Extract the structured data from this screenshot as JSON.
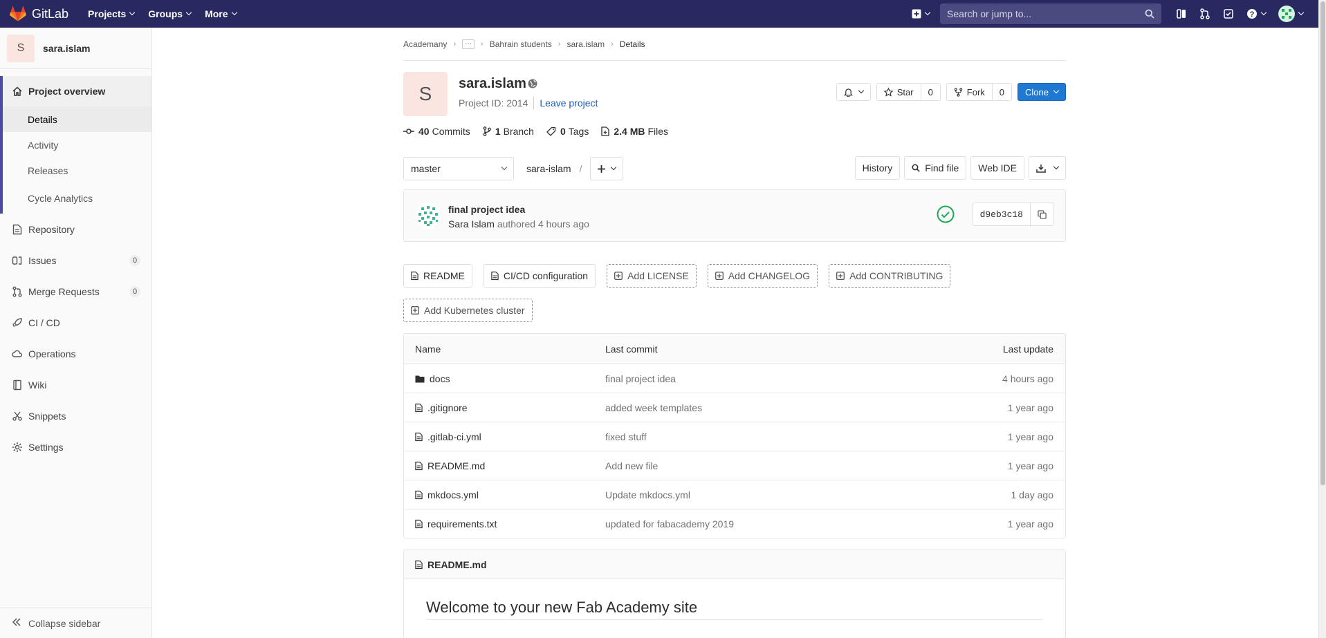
{
  "navbar": {
    "brand": "GitLab",
    "menu": [
      "Projects",
      "Groups",
      "More"
    ],
    "search_placeholder": "Search or jump to..."
  },
  "sidebar": {
    "project_initial": "S",
    "project_name": "sara.islam",
    "overview_label": "Project overview",
    "overview_items": [
      "Details",
      "Activity",
      "Releases",
      "Cycle Analytics"
    ],
    "items": [
      {
        "label": "Repository"
      },
      {
        "label": "Issues",
        "badge": "0"
      },
      {
        "label": "Merge Requests",
        "badge": "0"
      },
      {
        "label": "CI / CD"
      },
      {
        "label": "Operations"
      },
      {
        "label": "Wiki"
      },
      {
        "label": "Snippets"
      },
      {
        "label": "Settings"
      }
    ],
    "collapse_label": "Collapse sidebar"
  },
  "breadcrumb": {
    "items": [
      "Academany",
      "Bahrain students",
      "sara.islam",
      "Details"
    ]
  },
  "project": {
    "initial": "S",
    "title": "sara.islam",
    "id_text": "Project ID: 2014",
    "leave_label": "Leave project",
    "star_label": "Star",
    "star_count": "0",
    "fork_label": "Fork",
    "fork_count": "0",
    "clone_label": "Clone"
  },
  "stats": {
    "commits_count": "40",
    "commits_label": "Commits",
    "branch_count": "1",
    "branch_label": "Branch",
    "tags_count": "0",
    "tags_label": "Tags",
    "files_size": "2.4 MB",
    "files_label": "Files"
  },
  "toolbar": {
    "branch": "master",
    "path": "sara-islam",
    "path_sep": "/",
    "history": "History",
    "find_file": "Find file",
    "web_ide": "Web IDE"
  },
  "commit": {
    "title": "final project idea",
    "author": "Sara Islam",
    "meta": "authored 4 hours ago",
    "sha": "d9eb3c18"
  },
  "quick_links": [
    {
      "label": "README",
      "style": "solid",
      "icon": "file-icon"
    },
    {
      "label": "CI/CD configuration",
      "style": "solid",
      "icon": "file-icon"
    },
    {
      "label": "Add LICENSE",
      "style": "dashed",
      "icon": "plus-square-icon"
    },
    {
      "label": "Add CHANGELOG",
      "style": "dashed",
      "icon": "plus-square-icon"
    },
    {
      "label": "Add CONTRIBUTING",
      "style": "dashed",
      "icon": "plus-square-icon"
    },
    {
      "label": "Add Kubernetes cluster",
      "style": "dashed",
      "icon": "plus-square-icon"
    }
  ],
  "file_table": {
    "headers": [
      "Name",
      "Last commit",
      "Last update"
    ],
    "rows": [
      {
        "name": "docs",
        "type": "folder",
        "commit": "final project idea",
        "update": "4 hours ago"
      },
      {
        "name": ".gitignore",
        "type": "file",
        "commit": "added week templates",
        "update": "1 year ago"
      },
      {
        "name": ".gitlab-ci.yml",
        "type": "file",
        "commit": "fixed stuff",
        "update": "1 year ago"
      },
      {
        "name": "README.md",
        "type": "file",
        "commit": "Add new file",
        "update": "1 year ago"
      },
      {
        "name": "mkdocs.yml",
        "type": "file",
        "commit": "Update mkdocs.yml",
        "update": "1 day ago"
      },
      {
        "name": "requirements.txt",
        "type": "file",
        "commit": "updated for fabacademy 2019",
        "update": "1 year ago"
      }
    ]
  },
  "readme": {
    "filename": "README.md",
    "heading": "Welcome to your new Fab Academy site"
  },
  "colors": {
    "navbar": "#292961",
    "sidebar_active": "#4b4ba3",
    "primary": "#1f78d1",
    "link": "#1f5ab5",
    "success": "#1aaa55"
  }
}
